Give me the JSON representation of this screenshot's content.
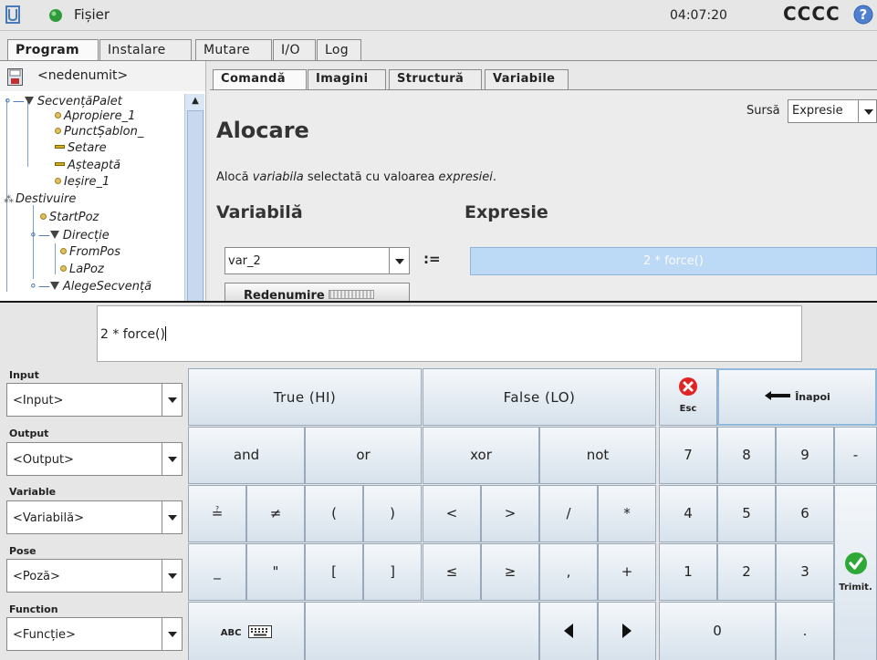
{
  "titlebar": {
    "file_menu": "Fișier",
    "clock": "04:07:20",
    "robot_name": "CCCC"
  },
  "main_tabs": [
    {
      "label": "Program",
      "active": true
    },
    {
      "label": "Instalare",
      "active": false
    },
    {
      "label": "Mutare",
      "active": false
    },
    {
      "label": "I/O",
      "active": false
    },
    {
      "label": "Log",
      "active": false
    }
  ],
  "tree": {
    "file_name": "<nedenumit>",
    "items": [
      {
        "label": "SecvențăPalet",
        "icon": "triangle"
      },
      {
        "label": "Apropiere_1",
        "icon": "waypoint"
      },
      {
        "label": "PunctȘablon_",
        "icon": "waypoint"
      },
      {
        "label": "Setare",
        "icon": "set"
      },
      {
        "label": "Așteaptă",
        "icon": "set"
      },
      {
        "label": "Ieșire_1",
        "icon": "waypoint"
      },
      {
        "label": "Destivuire",
        "icon": "destack"
      },
      {
        "label": "StartPoz",
        "icon": "waypoint"
      },
      {
        "label": "Direcție",
        "icon": "triangle"
      },
      {
        "label": "FromPos",
        "icon": "waypoint"
      },
      {
        "label": "LaPoz",
        "icon": "waypoint"
      },
      {
        "label": "AlegeSecvență",
        "icon": "triangle"
      }
    ]
  },
  "command_tabs": [
    {
      "label": "Comandă",
      "active": true
    },
    {
      "label": "Imagini",
      "active": false
    },
    {
      "label": "Structură",
      "active": false
    },
    {
      "label": "Variabile",
      "active": false
    }
  ],
  "command": {
    "title": "Alocare",
    "source_label": "Sursă",
    "source_value": "Expresie",
    "desc_prefix": "Alocă ",
    "desc_var": "variabila",
    "desc_mid": " selectată cu valoarea ",
    "desc_expr": "expresiei",
    "desc_suffix": ".",
    "variable_heading": "Variabilă",
    "expression_heading": "Expresie",
    "variable_value": "var_2",
    "assign_operator": ":=",
    "expression_value": "2 * force()",
    "rename_button": "Redenumire"
  },
  "keyboard": {
    "expression_text": "2 * force()",
    "side": [
      {
        "label": "Input",
        "value": "<Input>"
      },
      {
        "label": "Output",
        "value": "<Output>"
      },
      {
        "label": "Variable",
        "value": "<Variabilă>"
      },
      {
        "label": "Pose",
        "value": "<Poză>"
      },
      {
        "label": "Function",
        "value": "<Funcție>"
      }
    ],
    "keys": {
      "true": "True (HI)",
      "false": "False (LO)",
      "esc": "Esc",
      "back": "Înapoi",
      "and": "and",
      "or": "or",
      "xor": "xor",
      "not": "not",
      "eq": "≟",
      "neq": "≠",
      "lparen": "(",
      "rparen": ")",
      "lt": "<",
      "gt": ">",
      "slash": "/",
      "star": "*",
      "underscore": "_",
      "quote": "\"",
      "lbracket": "[",
      "rbracket": "]",
      "le": "≤",
      "ge": "≥",
      "comma": ",",
      "plus": "+",
      "abc": "ABC",
      "d7": "7",
      "d8": "8",
      "d9": "9",
      "minus": "-",
      "d4": "4",
      "d5": "5",
      "d6": "6",
      "d1": "1",
      "d2": "2",
      "d3": "3",
      "d0": "0",
      "dot": ".",
      "submit": "Trimit."
    }
  }
}
